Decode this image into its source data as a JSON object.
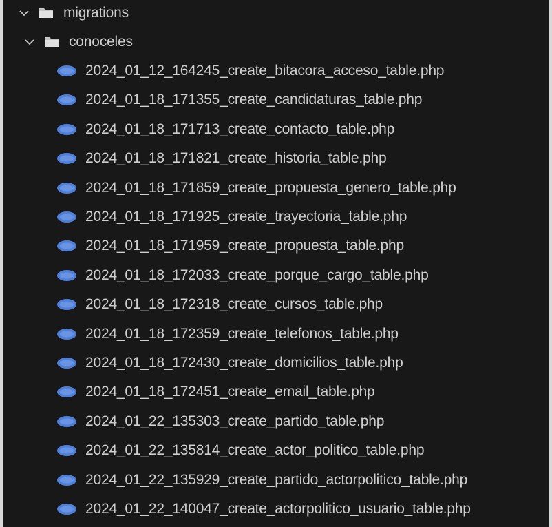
{
  "explorer": {
    "folders": [
      {
        "name": "migrations",
        "expanded": true,
        "icon": "folder-open-icon"
      },
      {
        "name": "conoceles",
        "expanded": true,
        "icon": "folder-open-icon"
      }
    ],
    "files": [
      "2024_01_12_164245_create_bitacora_acceso_table.php",
      "2024_01_18_171355_create_candidaturas_table.php",
      "2024_01_18_171713_create_contacto_table.php",
      "2024_01_18_171821_create_historia_table.php",
      "2024_01_18_171859_create_propuesta_genero_table.php",
      "2024_01_18_171925_create_trayectoria_table.php",
      "2024_01_18_171959_create_propuesta_table.php",
      "2024_01_18_172033_create_porque_cargo_table.php",
      "2024_01_18_172318_create_cursos_table.php",
      "2024_01_18_172359_create_telefonos_table.php",
      "2024_01_18_172430_create_domicilios_table.php",
      "2024_01_18_172451_create_email_table.php",
      "2024_01_22_135303_create_partido_table.php",
      "2024_01_22_135814_create_actor_politico_table.php",
      "2024_01_22_135929_create_partido_actorpolitico_table.php",
      "2024_01_22_140047_create_actorpolitico_usuario_table.php"
    ],
    "file_icon": "php-file-icon",
    "colors": {
      "background": "#181818",
      "text": "#cfcfcf",
      "php_icon": "#4f7fd6",
      "folder": "#c5c5c5"
    }
  }
}
